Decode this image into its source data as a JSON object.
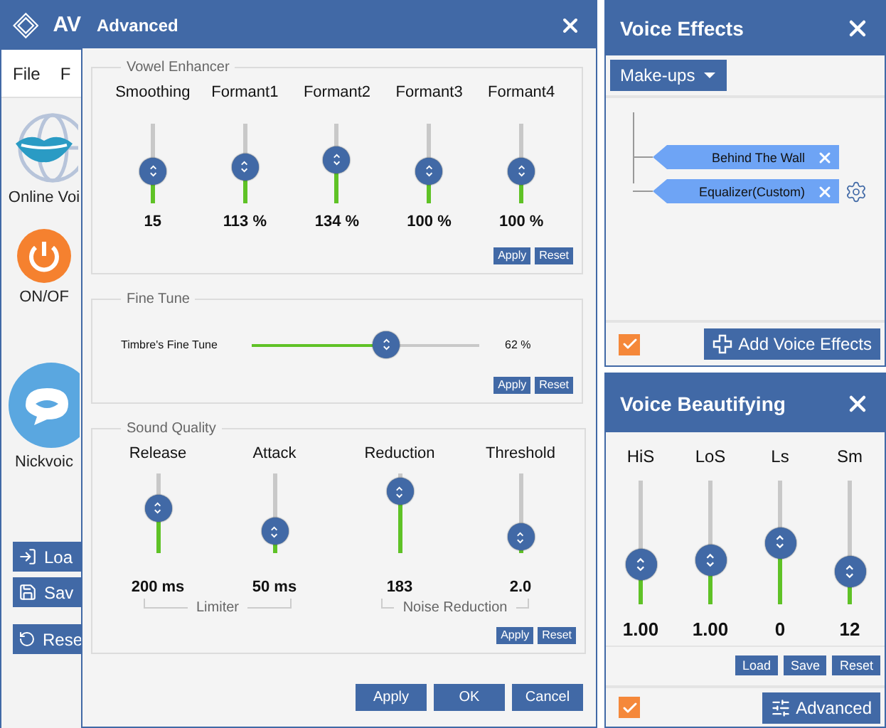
{
  "main_window": {
    "title": "AV",
    "menu": [
      "File",
      "F"
    ],
    "tools": [
      {
        "kind": "globe",
        "label": "Online Voi"
      },
      {
        "kind": "power",
        "label": "ON/OF"
      },
      {
        "kind": "chat",
        "label": "Nickvoic"
      }
    ],
    "buttons": [
      {
        "kind": "load",
        "label": "Loa"
      },
      {
        "kind": "save",
        "label": "Sav"
      },
      {
        "kind": "reset",
        "label": "Rese"
      }
    ]
  },
  "advanced_dialog": {
    "title": "Advanced",
    "vowel_enhancer": {
      "title": "Vowel Enhancer",
      "sliders": [
        {
          "label": "Smoothing",
          "level": 0.4,
          "reading": "15"
        },
        {
          "label": "Formant1",
          "level": 0.46,
          "reading": "113 %"
        },
        {
          "label": "Formant2",
          "level": 0.55,
          "reading": "134 %"
        },
        {
          "label": "Formant3",
          "level": 0.4,
          "reading": "100 %"
        },
        {
          "label": "Formant4",
          "level": 0.4,
          "reading": "100 %"
        }
      ],
      "buttons": [
        "Apply",
        "Reset"
      ]
    },
    "fine_tune": {
      "title": "Fine Tune",
      "slider": {
        "label": "Timbre's Fine Tune",
        "level": 0.59,
        "reading": "62 %"
      },
      "buttons": [
        "Apply",
        "Reset"
      ]
    },
    "sound_quality": {
      "title": "Sound Quality",
      "sliders": [
        {
          "label": "Release",
          "level": 0.57,
          "reading": "200 ms"
        },
        {
          "label": "Attack",
          "level": 0.27,
          "reading": "50 ms"
        },
        {
          "label": "Reduction",
          "level": 0.77,
          "reading": "183"
        },
        {
          "label": "Threshold",
          "level": 0.2,
          "reading": "2.0"
        }
      ],
      "groups": [
        "Limiter",
        "Noise Reduction"
      ],
      "buttons": [
        "Apply",
        "Reset"
      ]
    },
    "buttons": [
      "Apply",
      "OK",
      "Cancel"
    ]
  },
  "voice_effects": {
    "title": "Voice Effects",
    "dropdown": "Make-ups",
    "effects": [
      {
        "label": "Behind The Wall",
        "settings": false
      },
      {
        "label": "Equalizer(Custom)",
        "settings": true
      }
    ],
    "enabled": true,
    "add_button": "Add Voice Effects"
  },
  "voice_beautifying": {
    "title": "Voice Beautifying",
    "sliders": [
      {
        "label": "HiS",
        "level": 0.32,
        "reading": "1.00"
      },
      {
        "label": "LoS",
        "level": 0.36,
        "reading": "1.00"
      },
      {
        "label": "Ls",
        "level": 0.5,
        "reading": "0"
      },
      {
        "label": "Sm",
        "level": 0.26,
        "reading": "12"
      }
    ],
    "buttons": [
      "Load",
      "Save",
      "Reset"
    ],
    "enabled": true,
    "advanced_button": "Advanced"
  }
}
